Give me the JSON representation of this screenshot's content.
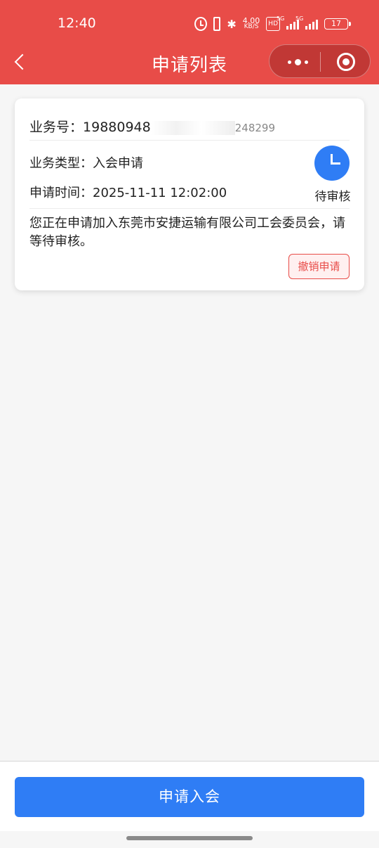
{
  "status_bar": {
    "time": "12:40",
    "net_speed": "4.00",
    "net_unit": "KB/S",
    "hd_label": "HD",
    "signal1_label": "5G",
    "signal2_label": "5G",
    "battery": "17"
  },
  "nav": {
    "title": "申请列表"
  },
  "card": {
    "biz_no_label": "业务号：",
    "biz_no_value": "19880948",
    "biz_no_tail": "248299",
    "biz_type_label": "业务类型：",
    "biz_type_value": "入会申请",
    "apply_time_label": "申请时间：",
    "apply_time_value": "2025-11-11 12:02:00",
    "status": "待审核",
    "description": "您正在申请加入东莞市安捷运输有限公司工会委员会，请等待审核。",
    "revoke_label": "撤销申请"
  },
  "bottom": {
    "join_label": "申请入会"
  },
  "colors": {
    "brand_red": "#e84c48",
    "primary_blue": "#2f7df5"
  }
}
